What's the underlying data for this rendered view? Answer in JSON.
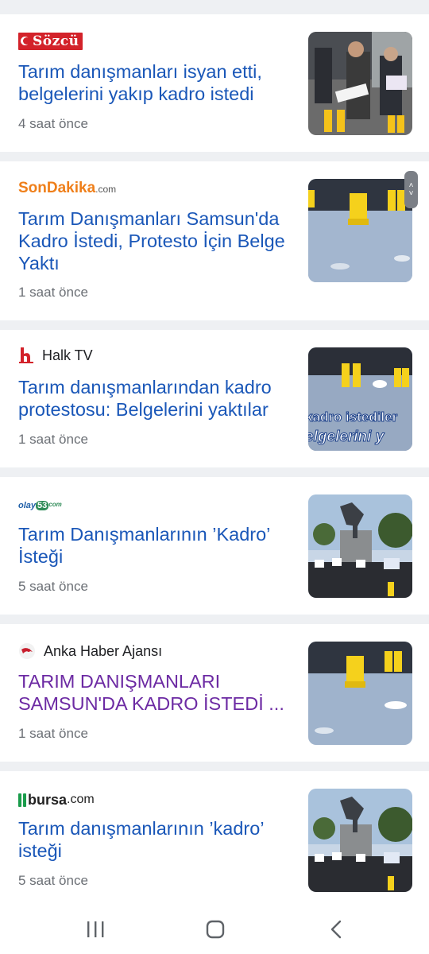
{
  "articles": [
    {
      "source": "Sözcü",
      "source_logo_text": "Sözcü",
      "title": "Tarım danışmanları isyan etti, belgelerini yakıp kadro istedi",
      "time": "4 saat önce",
      "visited": false
    },
    {
      "source": "SonDakika.com",
      "source_logo_text": "SonDakika",
      "source_logo_suffix": ".com",
      "title": "Tarım Danışmanları Samsun'da Kadro İstedi, Protesto İçin Belge Yaktı",
      "time": "1 saat önce",
      "visited": false
    },
    {
      "source": "Halk TV",
      "title": "Tarım danışmanlarından kadro protestosu: Belgelerini yaktılar",
      "time": "1 saat önce",
      "visited": false,
      "thumb_overlay_1": "kadro istediler",
      "thumb_overlay_2": "elgelerini y"
    },
    {
      "source": "olay53.com",
      "source_logo_text": "olay",
      "source_logo_num": "53",
      "source_logo_suffix": "com",
      "title": "Tarım Danışmanlarının ’Kadro’ İsteği",
      "time": "5 saat önce",
      "visited": false
    },
    {
      "source": "Anka Haber Ajansı",
      "title": "TARIM DANIŞMANLARI SAMSUN'DA KADRO İSTEDİ ...",
      "time": "1 saat önce",
      "visited": true
    },
    {
      "source": "bursa.com",
      "source_logo_text": "bursa",
      "source_logo_suffix": ".com",
      "title": "Tarım danışmanlarının ’kadro’ isteği",
      "time": "5 saat önce",
      "visited": false
    }
  ],
  "colors": {
    "title_link": "#1a57b8",
    "title_visited": "#6c2aa3",
    "time_text": "#6b6f75",
    "sozcu_red": "#d3222a",
    "sondakika_orange": "#ef7f1a",
    "bursa_green": "#1a9c4b"
  },
  "scroll_handle": {
    "up_glyph": "˄",
    "down_glyph": "˅"
  },
  "navbar": {
    "recents_icon": "recents-icon",
    "home_icon": "home-icon",
    "back_icon": "back-icon"
  }
}
